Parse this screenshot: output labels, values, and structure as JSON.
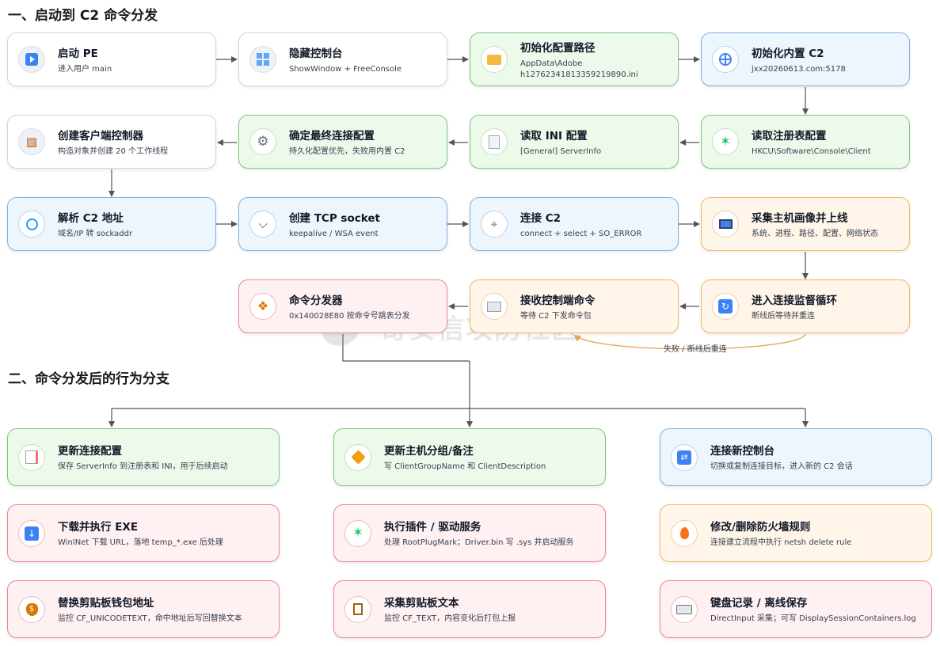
{
  "sections": {
    "s1": "一、启动到 C2 命令分发",
    "s2": "二、命令分发后的行为分支"
  },
  "flow": {
    "n1": {
      "title": "启动 PE",
      "sub": "进入用户 main",
      "icon": "play-icon"
    },
    "n2": {
      "title": "隐藏控制台",
      "sub": "ShowWindow + FreeConsole",
      "icon": "window-icon"
    },
    "n3": {
      "title": "初始化配置路径",
      "sub1": "AppData\\Adobe",
      "sub2": "h12762341813359219890.ini",
      "icon": "folder-icon"
    },
    "n4": {
      "title": "初始化内置 C2",
      "sub": "jxx20260613.com:5178",
      "icon": "globe-icon"
    },
    "n5": {
      "title": "读取注册表配置",
      "sub": "HKCU\\Software\\Console\\Client",
      "icon": "puzzle-icon"
    },
    "n6": {
      "title": "读取 INI 配置",
      "sub": "[General] ServerInfo",
      "icon": "document-icon"
    },
    "n7": {
      "title": "确定最终连接配置",
      "sub": "持久化配置优先，失败用内置 C2",
      "icon": "gear-icon"
    },
    "n8": {
      "title": "创建客户端控制器",
      "sub": "构造对象并创建 20 个工作线程",
      "icon": "spool-icon"
    },
    "n9": {
      "title": "解析 C2 地址",
      "sub": "域名/IP 转 sockaddr",
      "icon": "magnifier-icon"
    },
    "n10": {
      "title": "创建 TCP socket",
      "sub": "keepalive / WSA event",
      "icon": "plug-icon"
    },
    "n11": {
      "title": "连接 C2",
      "sub": "connect + select + SO_ERROR",
      "icon": "satellite-icon"
    },
    "n12": {
      "title": "采集主机画像并上线",
      "sub": "系统、进程、路径、配置、网络状态",
      "icon": "monitor-icon"
    },
    "n13": {
      "title": "进入连接监督循环",
      "sub": "断线后等待并重连",
      "icon": "repeat-icon"
    },
    "n14": {
      "title": "接收控制端命令",
      "sub": "等待 C2 下发命令包",
      "icon": "inbox-icon"
    },
    "n15": {
      "title": "命令分发器",
      "sub": "0x140028E80 按命令号跳表分发",
      "icon": "compass-icon"
    }
  },
  "loop_label": "失败 / 断线后重连",
  "watermark": "奇安信攻防社区",
  "branches": {
    "b1": {
      "title": "更新连接配置",
      "sub": "保存 ServerInfo 到注册表和 INI，用于后续启动",
      "icon": "memo-icon"
    },
    "b2": {
      "title": "更新主机分组/备注",
      "sub": "写 ClientGroupName 和 ClientDescription",
      "icon": "tag-icon"
    },
    "b3": {
      "title": "连接新控制台",
      "sub": "切换或复制连接目标，进入新的 C2 会话",
      "icon": "shuffle-icon"
    },
    "b4": {
      "title": "下载并执行 EXE",
      "sub": "WinINet 下载 URL，落地 temp_*.exe 后处理",
      "icon": "download-icon"
    },
    "b5": {
      "title": "执行插件 / 驱动服务",
      "sub": "处理 RootPlugMark；Driver.bin 写 .sys 并启动服务",
      "icon": "puzzle-icon"
    },
    "b6": {
      "title": "修改/删除防火墙规则",
      "sub": "连接建立流程中执行 netsh delete rule",
      "icon": "fire-icon"
    },
    "b7": {
      "title": "替换剪贴板钱包地址",
      "sub": "监控 CF_UNICODETEXT，命中地址后写回替换文本",
      "icon": "money-bag-icon"
    },
    "b8": {
      "title": "采集剪贴板文本",
      "sub": "监控 CF_TEXT，内容变化后打包上报",
      "icon": "clipboard-icon"
    },
    "b9": {
      "title": "键盘记录 / 离线保存",
      "sub": "DirectInput 采集；可写 DisplaySessionContainers.log",
      "icon": "keyboard-icon"
    }
  }
}
